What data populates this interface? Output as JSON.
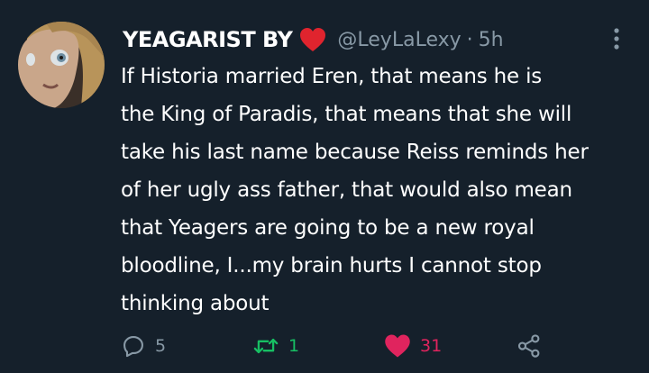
{
  "tweet": {
    "display_name": "YEAGARIST BY",
    "handle": "@LeyLaLexy",
    "separator": "·",
    "time": "5h",
    "lines": [
      "If Historia married Eren, that means he is",
      "the King of Paradis, that means that she will",
      "take his last name because Reiss reminds her",
      "of her ugly ass father, that would also mean",
      "that Yeagers are going to be a new royal",
      "bloodline, I...my brain hurts I cannot stop",
      "thinking about"
    ]
  },
  "actions": {
    "replies": "5",
    "retweets": "1",
    "likes": "31"
  },
  "icons": {
    "avatar": "avatar",
    "name_emoji": "red-heart-icon",
    "more": "more-vertical-icon",
    "reply": "reply-icon",
    "retweet": "retweet-icon",
    "like": "heart-icon",
    "share": "share-icon"
  },
  "colors": {
    "background": "#15202b",
    "text": "#ffffff",
    "muted": "#8899a6",
    "retweet": "#17bf63",
    "like": "#e0245e"
  }
}
